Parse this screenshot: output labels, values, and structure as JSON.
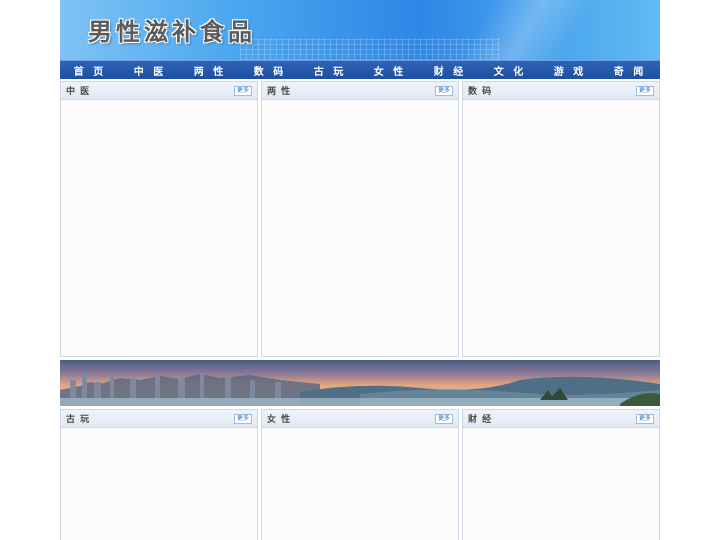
{
  "site_title": "男性滋补食品",
  "nav": [
    "首 页",
    "中 医",
    "两 性",
    "数 码",
    "古 玩",
    "女 性",
    "财 经",
    "文 化",
    "游 戏",
    "奇 闻"
  ],
  "more_label": "更多",
  "panels_row1": [
    "中 医",
    "两 性",
    "数 码"
  ],
  "panels_row2": [
    "古 玩",
    "女 性",
    "财 经"
  ]
}
